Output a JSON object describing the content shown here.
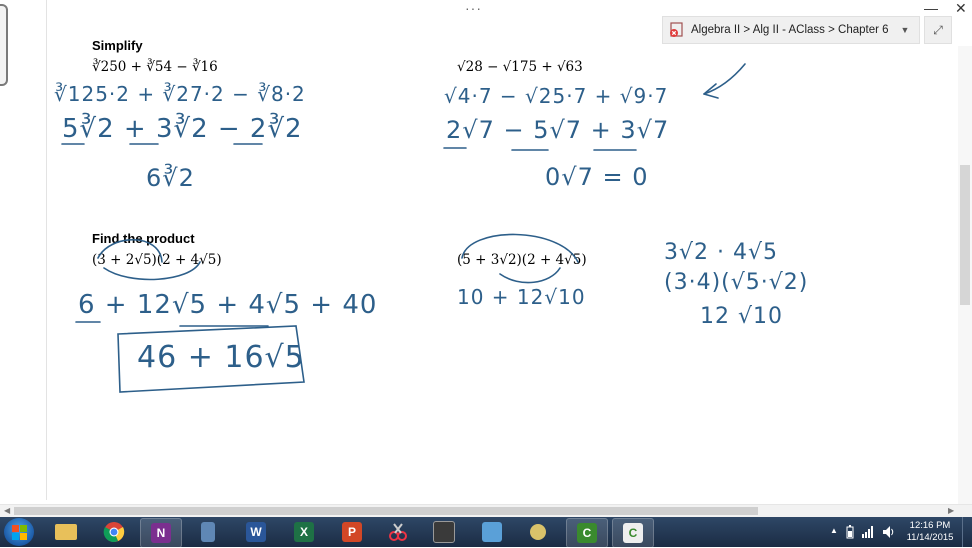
{
  "window": {
    "dots": "···",
    "minimize": "—",
    "close": "✕",
    "breadcrumb": "Algebra II > Alg II - AClass > Chapter 6",
    "breadcrumb_arrow": "▼",
    "expand": "⤢"
  },
  "page": {
    "simplify_heading": "Simplify",
    "product_heading": "Find the product",
    "printed": {
      "p1": "∛250 + ∛54 − ∛16",
      "p2": "√28 − √175 + √63",
      "p3": "(3 + 2√5)(2 + 4√5)",
      "p4": "(5 + 3√2)(2 + 4√5)"
    },
    "ink": {
      "a1": "∛125·2 + ∛27·2 − ∛8·2",
      "a2": "5∛2 + 3∛2 − 2∛2",
      "a3": "6∛2",
      "b1": "√4·7 − √25·7 + √9·7",
      "b2": "2√7 − 5√7 + 3√7",
      "b3": "0√7  = 0",
      "c1": "6 + 12√5 + 4√5 + 40",
      "c2": "46 + 16√5",
      "d1": "10 + 12√10",
      "e1": "3√2 · 4√5",
      "e2": "(3·4)(√5·√2)",
      "e3": "12 √10"
    }
  },
  "taskbar": {
    "apps": [
      {
        "name": "start-button"
      },
      {
        "name": "file-explorer-icon",
        "label": ""
      },
      {
        "name": "chrome-icon",
        "label": ""
      },
      {
        "name": "onenote-icon",
        "label": "N"
      },
      {
        "name": "app-device-icon",
        "label": ""
      },
      {
        "name": "word-icon",
        "label": "W"
      },
      {
        "name": "excel-icon",
        "label": "X"
      },
      {
        "name": "powerpoint-icon",
        "label": "P"
      },
      {
        "name": "snipping-tool-icon",
        "label": ""
      },
      {
        "name": "computer-network-icon",
        "label": ""
      },
      {
        "name": "control-panel-icon",
        "label": ""
      },
      {
        "name": "tool-icon",
        "label": ""
      },
      {
        "name": "camtasia-icon",
        "label": "C"
      },
      {
        "name": "camtasia-recorder-icon",
        "label": "C"
      }
    ],
    "tray": {
      "up_arrow": "▲",
      "time": "12:16 PM",
      "date": "11/14/2015"
    }
  },
  "colors": {
    "ink": "#2d5f8a",
    "taskbar": "#1f3350",
    "accent_onenote": "#7b2f8f",
    "accent_word": "#2a5699",
    "accent_excel": "#1e7145",
    "accent_ppt": "#d24726",
    "accent_camtasia": "#3a8a2e"
  }
}
